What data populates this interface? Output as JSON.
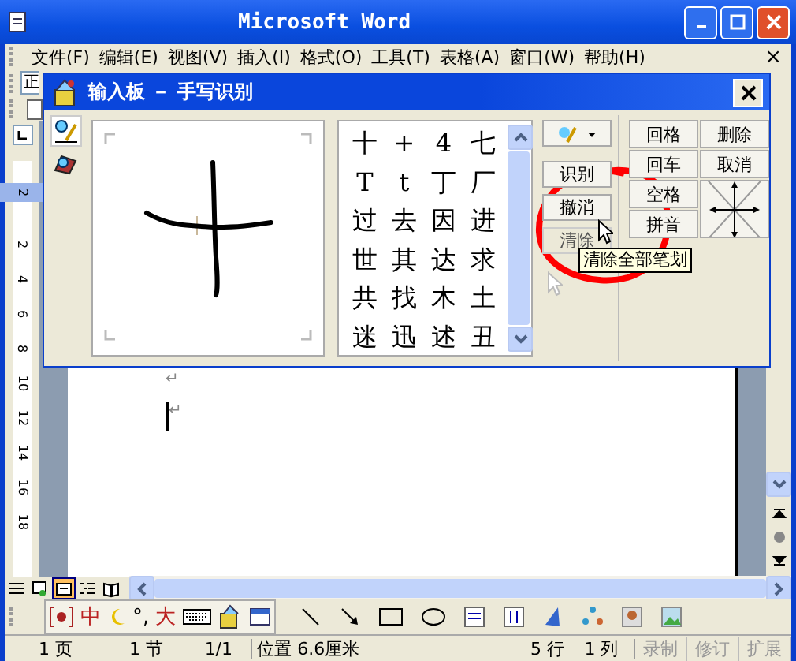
{
  "window": {
    "title": "Microsoft Word"
  },
  "menu": [
    {
      "label": "文件(F)"
    },
    {
      "label": "编辑(E)"
    },
    {
      "label": "视图(V)"
    },
    {
      "label": "插入(I)"
    },
    {
      "label": "格式(O)"
    },
    {
      "label": "工具(T)"
    },
    {
      "label": "表格(A)"
    },
    {
      "label": "窗口(W)"
    },
    {
      "label": "帮助(H)"
    }
  ],
  "menu_close": "×",
  "toolbar": {
    "style_field": "正"
  },
  "ime_pad": {
    "title": "输入板 － 手写识别",
    "candidates": [
      "十",
      "+",
      "4",
      "七",
      "T",
      "t",
      "丁",
      "厂",
      "过",
      "去",
      "因",
      "进",
      "世",
      "其",
      "达",
      "求",
      "共",
      "找",
      "木",
      "土",
      "迷",
      "迅",
      "述",
      "丑"
    ],
    "actions": [
      {
        "label": "识别",
        "hovered": false
      },
      {
        "label": "撤消",
        "hovered": false
      },
      {
        "label": "清除",
        "hovered": true
      }
    ],
    "keys": [
      "回格",
      "删除",
      "回车",
      "取消",
      "空格",
      "拼音"
    ],
    "tooltip": "清除全部笔划"
  },
  "ruler": {
    "numbers": [
      "2",
      "2",
      "4",
      "6",
      "8",
      "10",
      "12",
      "14",
      "16",
      "18"
    ]
  },
  "document": {
    "paragraph_marks": [
      "↵",
      "↵"
    ]
  },
  "view_buttons": [
    {
      "kind": "normal",
      "selected": false
    },
    {
      "kind": "web",
      "selected": false
    },
    {
      "kind": "print",
      "selected": true
    },
    {
      "kind": "outline",
      "selected": false
    },
    {
      "kind": "reading",
      "selected": false
    }
  ],
  "ime_status": {
    "mode": "中",
    "punct": "°,",
    "width": "大"
  },
  "status_bar": {
    "page": "1 页",
    "section": "1 节",
    "pages": "1/1",
    "position": "位置 6.6厘米",
    "line": "5 行",
    "column": "1 列",
    "modes": [
      {
        "label": "录制",
        "on": false
      },
      {
        "label": "修订",
        "on": false
      },
      {
        "label": "扩展",
        "on": false
      }
    ]
  }
}
